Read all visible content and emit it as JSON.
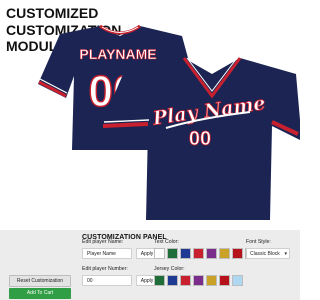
{
  "heading": {
    "lines": [
      "CUSTOMIZED",
      "CUSTOMIZATION",
      "MODULE"
    ]
  },
  "jersey": {
    "back_name": "PLAYNAME",
    "back_number": "00",
    "front_script": "Play Name",
    "front_number": "00",
    "colors": {
      "body": "#1b2452",
      "trim_red": "#c8202f",
      "trim_white": "#ffffff"
    }
  },
  "panel": {
    "title": "CUSTOMIZATION PANEL",
    "player_name": {
      "label": "Edit player Name:",
      "value": "Player Name",
      "apply": "Apply"
    },
    "player_number": {
      "label": "Edit player Number:",
      "value": "00",
      "apply": "Apply"
    },
    "text_color": {
      "label": "Text Color:",
      "swatches": [
        "#ffffff",
        "#1f6e3a",
        "#1f3a93",
        "#c8202f",
        "#7b2d8b",
        "#c9a227",
        "#b5121b",
        "#aed8f2"
      ]
    },
    "jersey_color": {
      "label": "Jersey Color:",
      "swatches": [
        "#1f6e3a",
        "#1f3a93",
        "#c8202f",
        "#7b2d8b",
        "#c9a227",
        "#b5121b",
        "#aed8f2"
      ]
    },
    "font_style": {
      "label": "Font Style:",
      "value": "Classic Block"
    },
    "reset_label": "Reset Customization",
    "cart_label": "Add To Cart",
    "cart_color": "#2f9e44"
  }
}
